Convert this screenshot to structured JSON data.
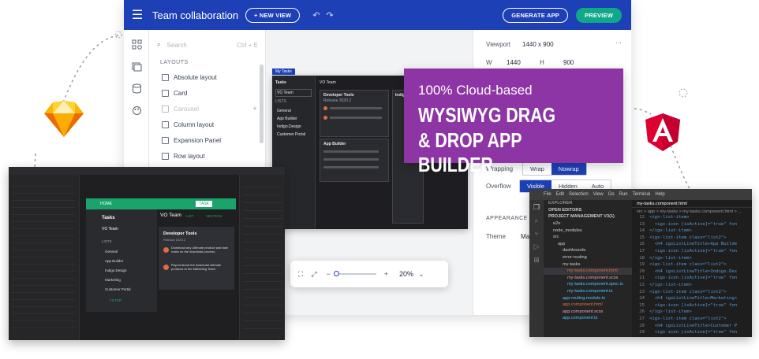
{
  "builder": {
    "title": "Team collaboration",
    "new_view": "+ NEW VIEW",
    "generate_app": "GENERATE APP",
    "preview": "PREVIEW",
    "search_placeholder": "Search",
    "search_shortcut": "Ctrl + E",
    "layouts_header": "LAYOUTS",
    "layout_items": [
      "Absolute layout",
      "Card",
      "Carousel",
      "Column layout",
      "Expansion Panel",
      "Row layout"
    ],
    "viewport_label": "Viewport",
    "viewport_value": "1440 x 900",
    "w_label": "W",
    "w_value": "1440",
    "h_label": "H",
    "h_value": "900",
    "wrapping_label": "Wrapping",
    "wrap": "Wrap",
    "nowrap": "Nowrap",
    "overflow_label": "Overflow",
    "visible": "Visible",
    "hidden": "Hidden",
    "auto": "Auto",
    "appearance": "APPEARANCE",
    "theme_label": "Theme",
    "theme_value": "Mat",
    "zoom_value": "20%"
  },
  "design": {
    "tab": "My Tasks",
    "tasks_title": "Tasks",
    "team": "VO Team",
    "lists": "LISTS",
    "lists_items": [
      "General",
      "App Builder",
      "Indigo.Design",
      "Customer Portal"
    ],
    "card1_title": "Developer Tools",
    "card1_sub": "Release 2020.2",
    "card2_title": "App Builder",
    "card3_title": "Indigo.Design",
    "team_label": "VO Team"
  },
  "promo": {
    "line1": "100% Cloud-based",
    "line2": "WYSIWYG DRAG",
    "line3": "& DROP APP BUILDER"
  },
  "leftapp": {
    "home": "HOME",
    "tasks": "Tasks",
    "team": "VO Team",
    "lists": "LISTS",
    "list_items": [
      "General",
      "App Builder",
      "Indigo.Design",
      "Marketing",
      "Customer Portal"
    ],
    "filter": "FILTER",
    "header_team": "VO Team",
    "list": "LIST",
    "section": "SECTION",
    "card_title": "Developer Tools",
    "card_sub": "Release 2020.2",
    "task1": "Download any Ultimate product and take notes on the download process",
    "task2": "Report about the download ultimate products to the Marketing Team",
    "new_task": "TASK"
  },
  "vscode": {
    "menu": [
      "File",
      "Edit",
      "Selection",
      "View",
      "Go",
      "Run",
      "Terminal",
      "Help"
    ],
    "explorer": "EXPLORER",
    "open_editors": "OPEN EDITORS",
    "project": "PROJECT MANAGEMENT V3(1)",
    "tree": [
      "e2e",
      "node_modules",
      "src",
      "app",
      "dashboards",
      "error-routing",
      "my-tasks",
      "my-tasks.component.html",
      "my-tasks.component.scss",
      "my-tasks.component.spec.ts",
      "my-tasks.component.ts",
      "app-routing.module.ts",
      "app.component.html",
      "app.component.scss",
      "app.component.ts"
    ],
    "tab": "my-tasks.component.html",
    "breadcrumb": "src > app > my-tasks > my-tasks.component.html > ...",
    "line_numbers": [
      "12",
      "13",
      "14",
      "15",
      "16",
      "17",
      "18",
      "19",
      "20",
      "21",
      "22",
      "23",
      "24",
      "25",
      "26",
      "27",
      "28",
      "29"
    ],
    "code": [
      "<igx-list-item>",
      "  <igx-icon [isActive]=\"true\" fon",
      "</igx-list-item>",
      "<igx-list-item class=\"list2\">",
      "  <h4 igxListLineTitle>App Builde",
      "  <igx-icon [isActive]=\"true\" fon",
      "</igx-list-item>",
      "<igx-list-item class=\"list2\">",
      "  <h4 igxListLineTitle>Indigo.Des",
      "  <igx-icon [isActive]=\"true\" fon",
      "</igx-list-item>",
      "<igx-list-item class=\"list2\">",
      "  <h4 igxListLineTitle>Marketing<",
      "  <igx-icon [isActive]=\"true\" fon",
      "</igx-list-item>",
      "<igx-list-item class=\"list2\">",
      "  <h4 igxListLineTitle>Customer P",
      "  <igx-icon [isActive]=\"true\" fon"
    ]
  },
  "colors": {
    "brand_blue": "#1e40b6",
    "accent_green": "#11a889",
    "promo_purple": "#8e35a6",
    "sketch_orange": "#f7a823",
    "angular_red": "#dd0031"
  }
}
